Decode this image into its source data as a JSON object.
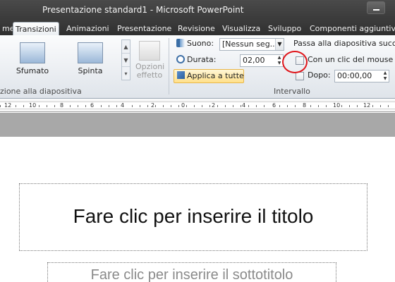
{
  "window": {
    "title": "Presentazione standard1  -  Microsoft PowerPoint"
  },
  "tabs": [
    {
      "label": "me",
      "active": false
    },
    {
      "label": "Transizioni",
      "active": true
    },
    {
      "label": "Animazioni",
      "active": false
    },
    {
      "label": "Presentazione",
      "active": false
    },
    {
      "label": "Revisione",
      "active": false
    },
    {
      "label": "Visualizza",
      "active": false
    },
    {
      "label": "Sviluppo",
      "active": false
    },
    {
      "label": "Componenti aggiuntivi",
      "active": false
    }
  ],
  "ribbon": {
    "transition_group": {
      "items": [
        {
          "label": "Sfumato"
        },
        {
          "label": "Spinta"
        }
      ],
      "label": "zione alla diapositiva",
      "effect_options": {
        "line1": "Opzioni",
        "line2": "effetto"
      }
    },
    "timing_group": {
      "sound_label": "Suono:",
      "sound_value": "[Nessun seg...",
      "duration_label": "Durata:",
      "duration_value": "02,00",
      "apply_all": "Applica a tutte",
      "advance_heading": "Passa alla diapositiva succes",
      "on_click_label": "Con un clic del mouse",
      "after_label": "Dopo:",
      "after_value": "00:00,00",
      "label": "Intervallo"
    }
  },
  "ruler": {
    "numbers": [
      "12",
      "10",
      "8",
      "6",
      "4",
      "2",
      "0",
      "2",
      "4",
      "6",
      "8",
      "10",
      "12"
    ]
  },
  "slide": {
    "title_placeholder": "Fare clic per inserire il titolo",
    "subtitle_placeholder": "Fare clic per inserire il sottotitolo"
  },
  "colors": {
    "ribbon_highlight": "#ffe08a",
    "annotation_circle": "#e0161b"
  }
}
